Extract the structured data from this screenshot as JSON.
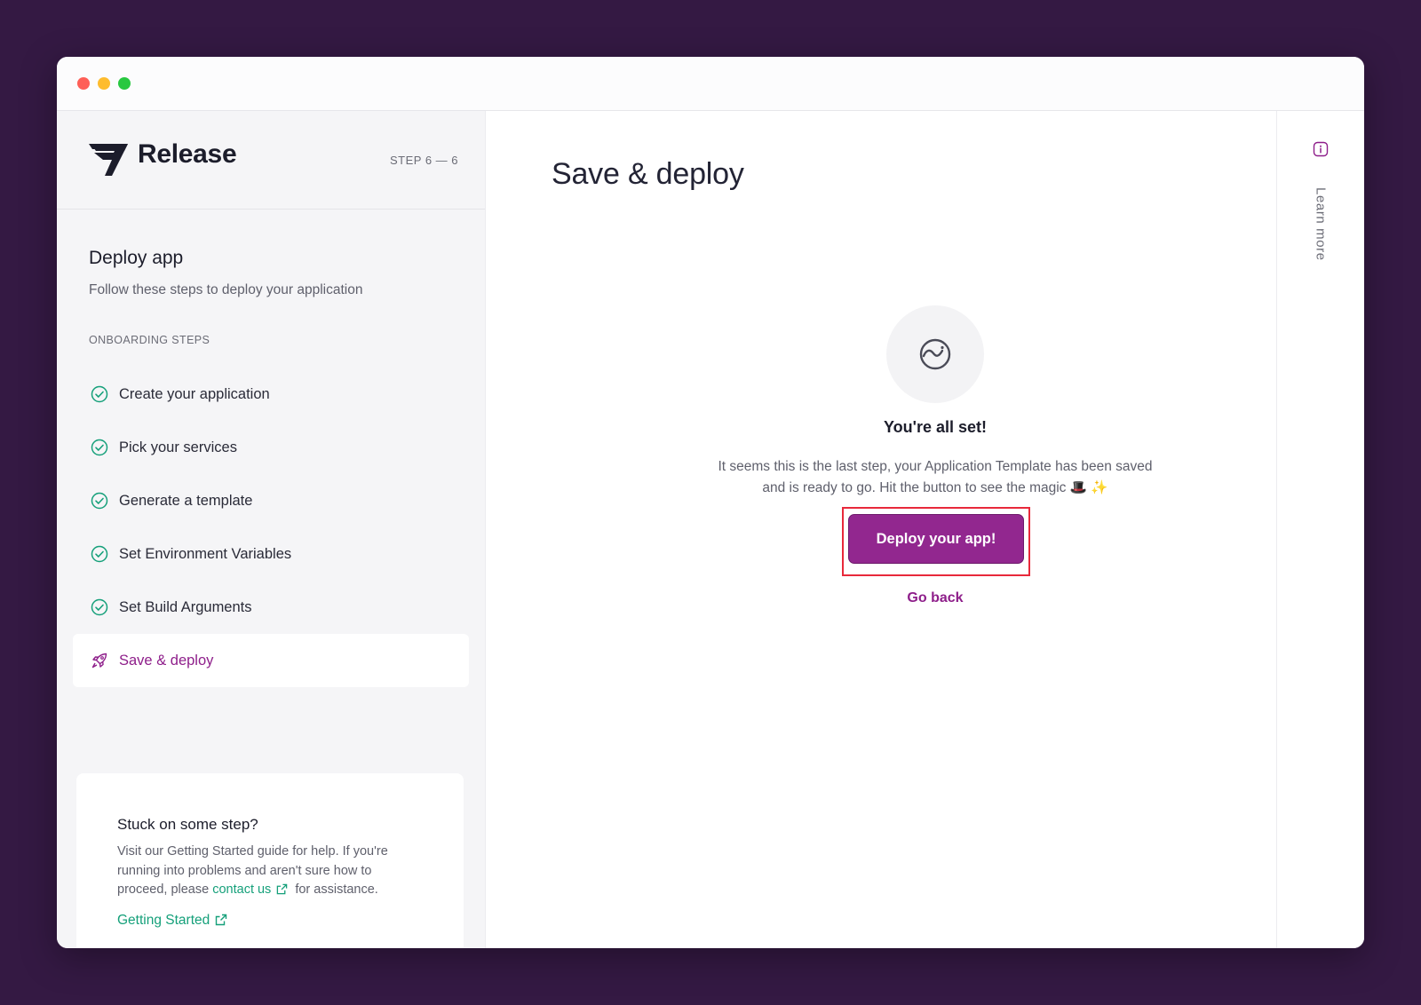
{
  "app": {
    "name": "Release",
    "step_indicator": "STEP 6 — 6"
  },
  "sidebar": {
    "title": "Deploy app",
    "subtitle": "Follow these steps to deploy your application",
    "section_label": "ONBOARDING STEPS",
    "steps": [
      {
        "label": "Create your application",
        "status": "complete",
        "icon": "check-circle-icon"
      },
      {
        "label": "Pick your services",
        "status": "complete",
        "icon": "check-circle-icon"
      },
      {
        "label": "Generate a template",
        "status": "complete",
        "icon": "check-circle-icon"
      },
      {
        "label": "Set Environment Variables",
        "status": "complete",
        "icon": "check-circle-icon"
      },
      {
        "label": "Set Build Arguments",
        "status": "complete",
        "icon": "check-circle-icon"
      },
      {
        "label": "Save & deploy",
        "status": "active",
        "icon": "rocket-icon"
      }
    ],
    "help": {
      "title": "Stuck on some step?",
      "body_before": "Visit our Getting Started guide for help. If you're running into problems and aren't sure how to proceed, please",
      "contact_link": "contact us",
      "body_after": "for assistance.",
      "getting_started_link": "Getting Started"
    }
  },
  "main": {
    "title": "Save & deploy",
    "status_title": "You're all set!",
    "description": "It seems this is the last step, your Application Template has been saved and is ready to go. Hit the button to see the magic 🎩 ✨",
    "deploy_button": "Deploy your app!",
    "go_back": "Go back"
  },
  "rail": {
    "learn_more": "Learn more",
    "icon": "info-icon"
  },
  "colors": {
    "background": "#341943",
    "accent": "#92278f",
    "success": "#15a07a",
    "highlight": "#e8293b"
  }
}
